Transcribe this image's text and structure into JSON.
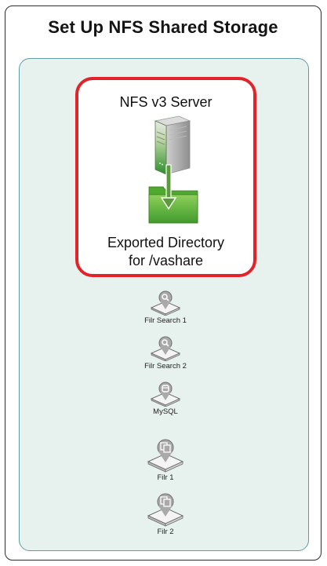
{
  "title": "Set Up NFS Shared Storage",
  "nfs_server": {
    "label": "NFS v3 Server",
    "export_line1": "Exported Directory",
    "export_line2": "for /vashare",
    "icon": "server-tower-icon",
    "folder_icon": "folder-icon",
    "arrow_icon": "arrow-down-icon"
  },
  "appliances": [
    {
      "label": "Filr Search 1",
      "icon": "search-appliance-icon"
    },
    {
      "label": "Filr Search 2",
      "icon": "search-appliance-icon"
    },
    {
      "label": "MySQL",
      "icon": "database-appliance-icon"
    },
    {
      "label": "Filr 1",
      "icon": "filr-appliance-icon"
    },
    {
      "label": "Filr 2",
      "icon": "filr-appliance-icon"
    }
  ],
  "colors": {
    "frame_border": "#2c2c2c",
    "panel_fill": "#e7f1ee",
    "panel_border": "#5f9da2",
    "highlight_border": "#e32229",
    "server_green": "#3aa13a",
    "folder_green": "#5cb53a",
    "appliance_gray": "#9a9a9a"
  }
}
